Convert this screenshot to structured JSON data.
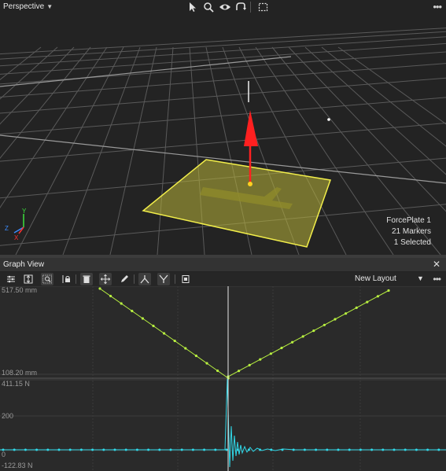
{
  "viewport": {
    "title": "Perspective",
    "tools": [
      "select-icon",
      "zoom-icon",
      "eye-icon",
      "camera-icon",
      "marquee-select-icon"
    ],
    "info": {
      "line1": "ForcePlate 1",
      "line2": "21 Markers",
      "line3": "1 Selected"
    },
    "axes": {
      "y": "Y",
      "z": "Z",
      "x": "X"
    },
    "colors": {
      "forceplate": "#c9c63a",
      "force_vector": "#ff2020",
      "axis_x": "#ff3030",
      "axis_y": "#3ce03c",
      "axis_z": "#3c8cff"
    }
  },
  "graph_view": {
    "title": "Graph View",
    "layout_name": "New Layout",
    "toolbar_icons": [
      "settings-sliders-icon",
      "fit-vertical-icon",
      "zoom-box-icon",
      "lock-icon",
      "delete-icon",
      "move-icon",
      "pencil-icon",
      "merge-icon",
      "split-icon",
      "clip-icon"
    ],
    "top_plot": {
      "y_max_label": "517.50 mm",
      "y_min_label": "108.20 mm",
      "color": "#b8f040"
    },
    "bottom_plot": {
      "y_max_label": "411.15 N",
      "y_mid_label": "200",
      "y_zero_label": "0",
      "y_min_label": "-122.83 N",
      "color": "#30d8e8"
    }
  }
}
